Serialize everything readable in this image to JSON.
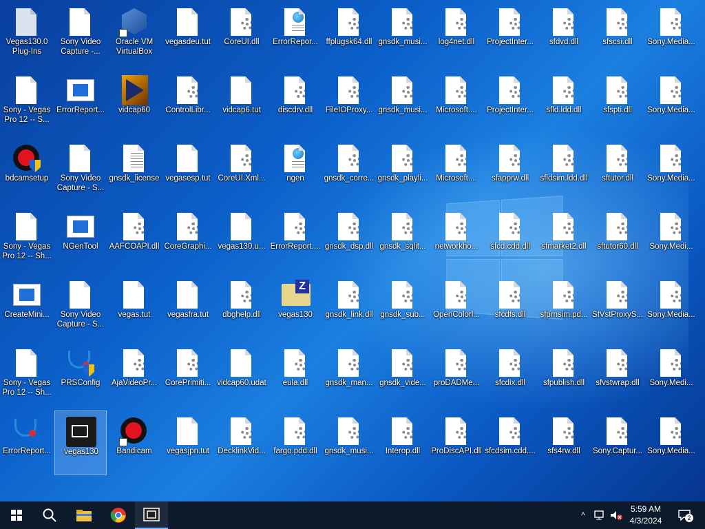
{
  "desktop": {
    "columns": [
      [
        {
          "label": "Vegas130.0 Plug-Ins",
          "kind": "folder-shadow",
          "selected": false
        },
        {
          "label": "Sony - Vegas Pro 12 -- S...",
          "kind": "doc"
        },
        {
          "label": "bdcamsetup",
          "kind": "rec-shield"
        },
        {
          "label": "Sony - Vegas Pro 12 -- Sh...",
          "kind": "doc"
        },
        {
          "label": "CreateMini...",
          "kind": "bluewin"
        },
        {
          "label": "Sony - Vegas Pro 12 -- Sh...",
          "kind": "doc"
        },
        {
          "label": "ErrorReport...",
          "kind": "steth"
        }
      ],
      [
        {
          "label": "Sony Video Capture -...",
          "kind": "doc"
        },
        {
          "label": "ErrorReport...",
          "kind": "bluewin"
        },
        {
          "label": "Sony Video Capture - S...",
          "kind": "doc"
        },
        {
          "label": "NGenTool",
          "kind": "bluewin"
        },
        {
          "label": "Sony Video Capture - S...",
          "kind": "doc"
        },
        {
          "label": "PRSConfig",
          "kind": "steth-shield"
        },
        {
          "label": "vegas130",
          "kind": "film",
          "selected": true
        }
      ],
      [
        {
          "label": "Oracle VM VirtualBox",
          "kind": "vbox",
          "shortcut": true
        },
        {
          "label": "vidcap60",
          "kind": "vcap"
        },
        {
          "label": "gnsdk_license",
          "kind": "text"
        },
        {
          "label": "AAFCOAPI.dll",
          "kind": "gear"
        },
        {
          "label": "vegas.tut",
          "kind": "doc"
        },
        {
          "label": "AjaVideoPr...",
          "kind": "gear"
        },
        {
          "label": "Bandicam",
          "kind": "rec",
          "shortcut": true
        }
      ],
      [
        {
          "label": "vegasdeu.tut",
          "kind": "doc"
        },
        {
          "label": "ControlLibr...",
          "kind": "gear"
        },
        {
          "label": "vegasesp.tut",
          "kind": "doc"
        },
        {
          "label": "CoreGraphi...",
          "kind": "gear"
        },
        {
          "label": "vegasfra.tut",
          "kind": "doc"
        },
        {
          "label": "CorePrimiti...",
          "kind": "gear"
        },
        {
          "label": "vegasjpn.tut",
          "kind": "doc"
        }
      ],
      [
        {
          "label": "CoreUI.dll",
          "kind": "gear"
        },
        {
          "label": "vidcap6.tut",
          "kind": "doc"
        },
        {
          "label": "CoreUI.Xml...",
          "kind": "gear"
        },
        {
          "label": "vegas130.u...",
          "kind": "doc"
        },
        {
          "label": "dbghelp.dll",
          "kind": "gear"
        },
        {
          "label": "vidcap60.udat",
          "kind": "doc"
        },
        {
          "label": "DecklinkVid...",
          "kind": "gear"
        }
      ],
      [
        {
          "label": "ErrorRepor...",
          "kind": "web"
        },
        {
          "label": "discdrv.dll",
          "kind": "gear"
        },
        {
          "label": "ngen",
          "kind": "web"
        },
        {
          "label": "ErrorReport....",
          "kind": "gear"
        },
        {
          "label": "vegas130",
          "kind": "zip"
        },
        {
          "label": "eula.dll",
          "kind": "gear"
        },
        {
          "label": "fargo.pdd.dll",
          "kind": "gear"
        }
      ],
      [
        {
          "label": "ffplugsk64.dll",
          "kind": "gear"
        },
        {
          "label": "FileIOProxy...",
          "kind": "gear"
        },
        {
          "label": "gnsdk_corre...",
          "kind": "gear"
        },
        {
          "label": "gnsdk_dsp.dll",
          "kind": "gear"
        },
        {
          "label": "gnsdk_link.dll",
          "kind": "gear"
        },
        {
          "label": "gnsdk_man...",
          "kind": "gear"
        },
        {
          "label": "gnsdk_musi...",
          "kind": "gear"
        }
      ],
      [
        {
          "label": "gnsdk_musi...",
          "kind": "gear"
        },
        {
          "label": "gnsdk_musi...",
          "kind": "gear"
        },
        {
          "label": "gnsdk_playli...",
          "kind": "gear"
        },
        {
          "label": "gnsdk_sqlit...",
          "kind": "gear"
        },
        {
          "label": "gnsdk_sub...",
          "kind": "gear"
        },
        {
          "label": "gnsdk_vide...",
          "kind": "gear"
        },
        {
          "label": "Interop.dll",
          "kind": "gear"
        }
      ],
      [
        {
          "label": "log4net.dll",
          "kind": "gear"
        },
        {
          "label": "Microsoft....",
          "kind": "gear"
        },
        {
          "label": "Microsoft....",
          "kind": "gear"
        },
        {
          "label": "networkho...",
          "kind": "gear"
        },
        {
          "label": "OpenColorl...",
          "kind": "gear"
        },
        {
          "label": "proDADMe...",
          "kind": "gear"
        },
        {
          "label": "ProDiscAPI.dll",
          "kind": "gear"
        }
      ],
      [
        {
          "label": "ProjectInter...",
          "kind": "gear"
        },
        {
          "label": "ProjectInter...",
          "kind": "gear"
        },
        {
          "label": "sfapprw.dll",
          "kind": "gear"
        },
        {
          "label": "sfcd.cdd.dll",
          "kind": "gear"
        },
        {
          "label": "sfcdfs.dll",
          "kind": "gear"
        },
        {
          "label": "sfcdix.dll",
          "kind": "gear"
        },
        {
          "label": "sfcdsim.cdd....",
          "kind": "gear"
        }
      ],
      [
        {
          "label": "sfdvd.dll",
          "kind": "gear"
        },
        {
          "label": "sfld.ldd.dll",
          "kind": "gear"
        },
        {
          "label": "sfldsim.ldd.dll",
          "kind": "gear"
        },
        {
          "label": "sfmarket2.dll",
          "kind": "gear"
        },
        {
          "label": "sfprnsim.pd...",
          "kind": "gear"
        },
        {
          "label": "sfpublish.dll",
          "kind": "gear"
        },
        {
          "label": "sfs4rw.dll",
          "kind": "gear"
        }
      ],
      [
        {
          "label": "sfscsi.dll",
          "kind": "gear"
        },
        {
          "label": "sfspti.dll",
          "kind": "gear"
        },
        {
          "label": "sftutor.dll",
          "kind": "gear"
        },
        {
          "label": "sftutor60.dll",
          "kind": "gear"
        },
        {
          "label": "SfVstProxyS...",
          "kind": "gear"
        },
        {
          "label": "sfvstwrap.dll",
          "kind": "gear"
        },
        {
          "label": "Sony.Captur...",
          "kind": "gear"
        }
      ],
      [
        {
          "label": "Sony.Media...",
          "kind": "gear"
        },
        {
          "label": "Sony.Media...",
          "kind": "gear"
        },
        {
          "label": "Sony.Media...",
          "kind": "gear"
        },
        {
          "label": "Sony.Medi...",
          "kind": "gear"
        },
        {
          "label": "Sony.Media...",
          "kind": "gear"
        },
        {
          "label": "Sony.Medi...",
          "kind": "gear"
        },
        {
          "label": "Sony.Media...",
          "kind": "gear"
        }
      ]
    ]
  },
  "taskbar": {
    "start_icon": "windows-logo-icon",
    "search_icon": "search-icon",
    "pinned": [
      {
        "name": "file-explorer",
        "icon": "folder-icon",
        "color": "#f0c040"
      },
      {
        "name": "google-chrome",
        "icon": "chrome-icon",
        "color": "#e0382c"
      },
      {
        "name": "vegas130",
        "icon": "film-icon",
        "color": "#ffffff",
        "active": true
      }
    ],
    "tray": {
      "chevron": "^",
      "time": "5:59 AM",
      "date": "4/3/2024",
      "notifications_count": "2"
    }
  },
  "colors": {
    "taskbar": "#0c1a2c",
    "accent": "#7ab5ff"
  }
}
